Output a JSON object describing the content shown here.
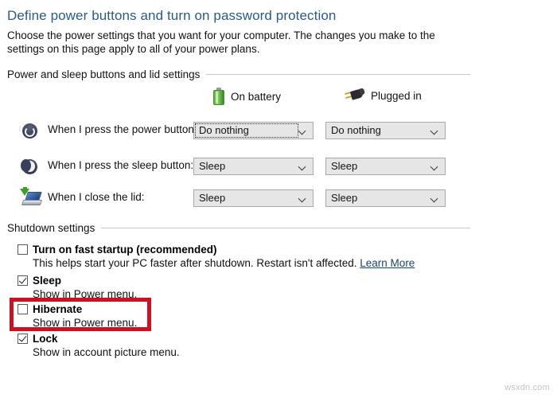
{
  "page": {
    "title": "Define power buttons and turn on password protection",
    "description": "Choose the power settings that you want for your computer. The changes you make to the settings on this page apply to all of your power plans."
  },
  "groups": {
    "power_and_sleep": "Power and sleep buttons and lid settings",
    "shutdown": "Shutdown settings"
  },
  "columns": [
    {
      "label": "On battery",
      "icon": "battery-icon"
    },
    {
      "label": "Plugged in",
      "icon": "power-plug-icon"
    }
  ],
  "settings_rows": [
    {
      "icon": "power-button-icon",
      "label": "When I press the power button:",
      "on_battery": "Do nothing",
      "plugged_in": "Do nothing",
      "focused": "on_battery"
    },
    {
      "icon": "sleep-moon-icon",
      "label": "When I press the sleep button:",
      "on_battery": "Sleep",
      "plugged_in": "Sleep",
      "focused": ""
    },
    {
      "icon": "laptop-lid-icon",
      "label": "When I close the lid:",
      "on_battery": "Sleep",
      "plugged_in": "Sleep",
      "focused": ""
    }
  ],
  "shutdown_options": [
    {
      "title": "Turn on fast startup (recommended)",
      "description": "This helps start your PC faster after shutdown. Restart isn't affected.",
      "link": "Learn More",
      "checked": false,
      "highlighted": false
    },
    {
      "title": "Sleep",
      "description": "Show in Power menu.",
      "link": "",
      "checked": true,
      "highlighted": false
    },
    {
      "title": "Hibernate",
      "description": "Show in Power menu.",
      "link": "",
      "checked": false,
      "highlighted": true
    },
    {
      "title": "Lock",
      "description": "Show in account picture menu.",
      "link": "",
      "checked": true,
      "highlighted": false
    }
  ],
  "watermark": "wsxdn.com",
  "colors": {
    "heading": "#2a5a8c",
    "link": "#17447a",
    "annotation": "#cc1122",
    "dropdown_bg": "#e6e6e6",
    "battery_green": "#5fae42"
  }
}
